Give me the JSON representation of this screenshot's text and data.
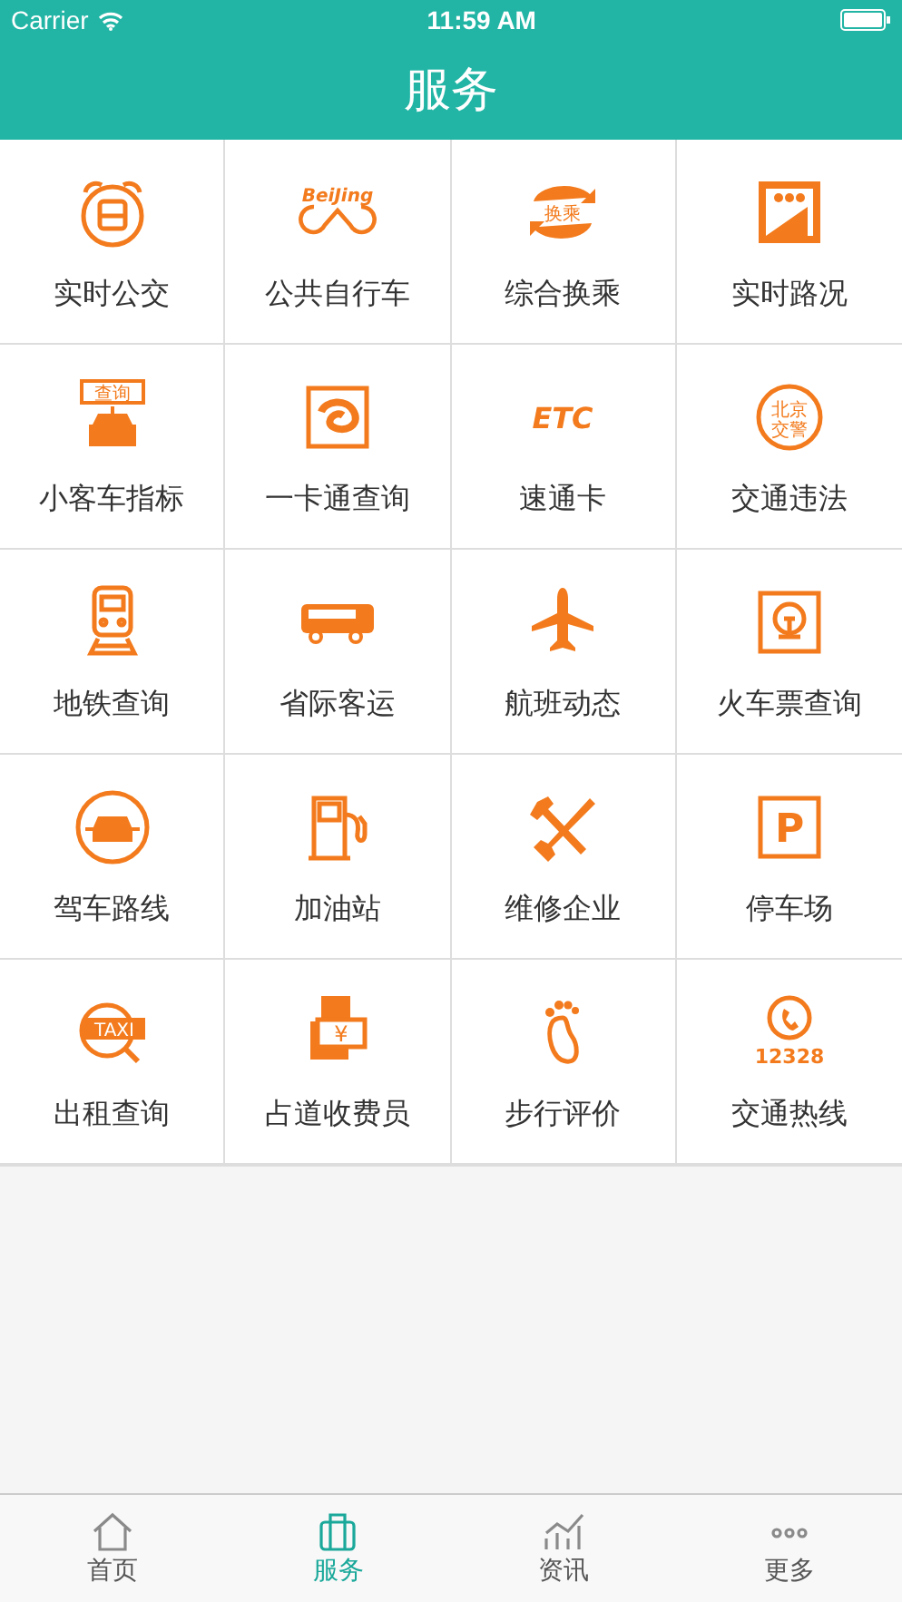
{
  "status_bar": {
    "carrier": "Carrier",
    "time": "11:59 AM"
  },
  "header": {
    "title": "服务"
  },
  "services": [
    {
      "label": "实时公交"
    },
    {
      "label": "公共自行车",
      "icon_text": "BeiJing"
    },
    {
      "label": "综合换乘",
      "icon_text": "换乘"
    },
    {
      "label": "实时路况"
    },
    {
      "label": "小客车指标",
      "icon_text": "查询"
    },
    {
      "label": "一卡通查询"
    },
    {
      "label": "速通卡",
      "icon_text": "ETC"
    },
    {
      "label": "交通违法",
      "icon_text": "北京交警"
    },
    {
      "label": "地铁查询"
    },
    {
      "label": "省际客运"
    },
    {
      "label": "航班动态"
    },
    {
      "label": "火车票查询"
    },
    {
      "label": "驾车路线"
    },
    {
      "label": "加油站"
    },
    {
      "label": "维修企业"
    },
    {
      "label": "停车场",
      "icon_text": "P"
    },
    {
      "label": "出租查询",
      "icon_text": "TAXI"
    },
    {
      "label": "占道收费员",
      "icon_text": "¥"
    },
    {
      "label": "步行评价"
    },
    {
      "label": "交通热线",
      "icon_text": "12328"
    }
  ],
  "tab_bar": [
    {
      "label": "首页",
      "selected": false
    },
    {
      "label": "服务",
      "selected": true
    },
    {
      "label": "资讯",
      "selected": false
    },
    {
      "label": "更多",
      "selected": false
    }
  ]
}
